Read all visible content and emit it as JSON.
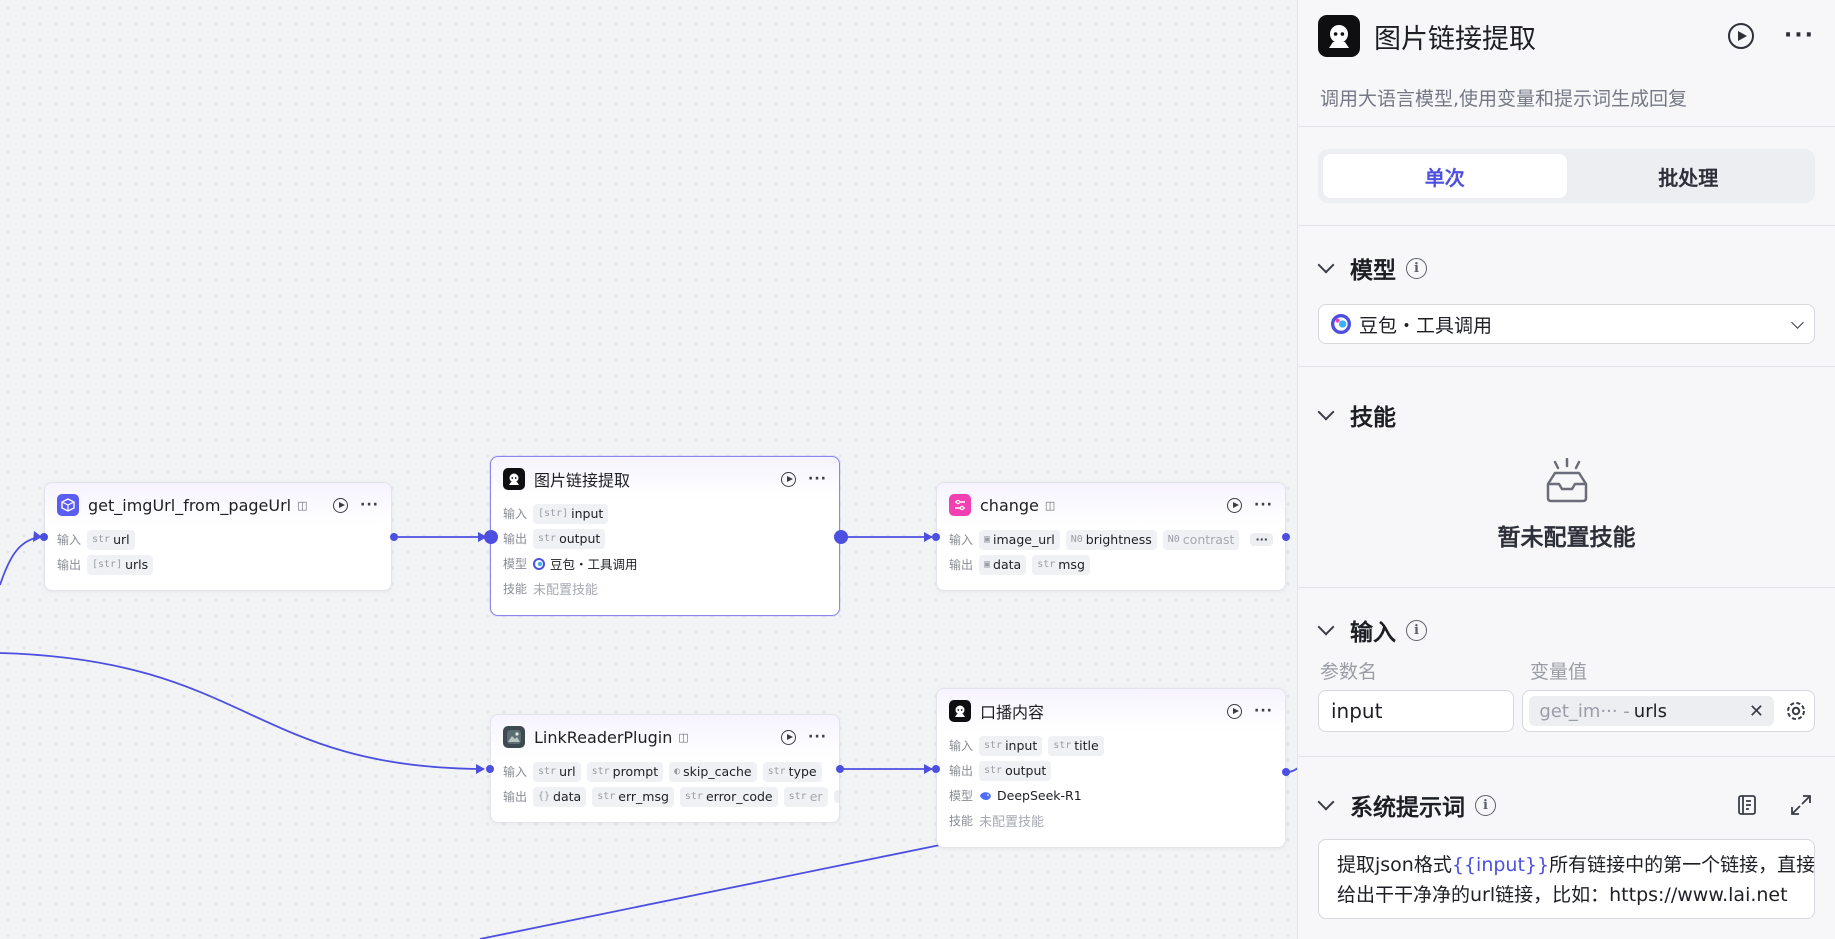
{
  "nodes": {
    "get_img": {
      "title": "get_imgUrl_from_pageUrl",
      "input_label": "输入",
      "output_label": "输出",
      "inputs": [
        {
          "type": "str",
          "name": "url"
        }
      ],
      "outputs": [
        {
          "type": "[str]",
          "name": "urls"
        }
      ]
    },
    "extract": {
      "title": "图片链接提取",
      "input_label": "输入",
      "output_label": "输出",
      "model_label": "模型",
      "skill_label": "技能",
      "inputs": [
        {
          "type": "[str]",
          "name": "input"
        }
      ],
      "outputs": [
        {
          "type": "str",
          "name": "output"
        }
      ],
      "model": "豆包・工具调用",
      "skill": "未配置技能"
    },
    "change": {
      "title": "change",
      "input_label": "输入",
      "output_label": "输出",
      "inputs": [
        {
          "type": "img",
          "name": "image_url"
        },
        {
          "type": "N0",
          "name": "brightness"
        },
        {
          "type": "N0",
          "name": "contrast"
        }
      ],
      "outputs": [
        {
          "type": "img",
          "name": "data"
        },
        {
          "type": "str",
          "name": "msg"
        }
      ]
    },
    "link_reader": {
      "title": "LinkReaderPlugin",
      "input_label": "输入",
      "output_label": "输出",
      "inputs": [
        {
          "type": "str",
          "name": "url"
        },
        {
          "type": "str",
          "name": "prompt"
        },
        {
          "type": "bool",
          "name": "skip_cache"
        },
        {
          "type": "str",
          "name": "type"
        }
      ],
      "outputs": [
        {
          "type": "{}",
          "name": "data"
        },
        {
          "type": "str",
          "name": "err_msg"
        },
        {
          "type": "str",
          "name": "error_code"
        },
        {
          "type": "str",
          "name": "er"
        }
      ]
    },
    "broadcast": {
      "title": "口播内容",
      "input_label": "输入",
      "output_label": "输出",
      "model_label": "模型",
      "skill_label": "技能",
      "inputs": [
        {
          "type": "str",
          "name": "input"
        },
        {
          "type": "str",
          "name": "title"
        }
      ],
      "outputs": [
        {
          "type": "str",
          "name": "output"
        }
      ],
      "model": "DeepSeek-R1",
      "skill": "未配置技能"
    }
  },
  "panel": {
    "title": "图片链接提取",
    "description": "调用大语言模型,使用变量和提示词生成回复",
    "tabs": [
      {
        "label": "单次",
        "active": true
      },
      {
        "label": "批处理",
        "active": false
      }
    ],
    "model_section": {
      "title": "模型",
      "selected": "豆包・工具调用"
    },
    "skill_section": {
      "title": "技能",
      "empty_text": "暂未配置技能"
    },
    "input_section": {
      "title": "输入",
      "param_name_header": "参数名",
      "param_value_header": "变量值",
      "param_name": "input",
      "param_value_source": "get_im··· -",
      "param_value_field": "urls"
    },
    "system_prompt": {
      "title": "系统提示词",
      "line1_a": "提取json格式",
      "line1_var": "{{input}}",
      "line1_b": "所有链接中的第一个链接，直接",
      "line2": "给出干干净净的url链接，比如：https://www.lai.net"
    }
  },
  "colors": {
    "accent": "#4c4fe0",
    "edge": "#4c4fe0",
    "plugin_icon_bg": "#5b5cf0",
    "change_icon_bg": "#f23fb2",
    "llm_icon_bg": "#0f0f12"
  }
}
